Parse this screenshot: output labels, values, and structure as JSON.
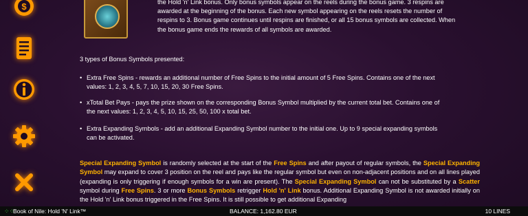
{
  "sidebar": {
    "items": [
      {
        "name": "coins",
        "icon": "coin-stack-icon"
      },
      {
        "name": "paytable",
        "icon": "scroll-icon"
      },
      {
        "name": "info",
        "icon": "info-icon"
      },
      {
        "name": "settings",
        "icon": "gear-icon"
      },
      {
        "name": "close",
        "icon": "close-icon"
      }
    ],
    "icon_color": "#ff9900"
  },
  "intro_lines": [
    "the Hold 'n' Link bonus. Only bonus symbols appear on the reels during the bonus game. 3 respins are",
    "awarded at the beginning of the bonus. Each new symbol appearing on the reels resets the number of",
    "respins to 3. Bonus game continues until respins are finished, or all 15 bonus symbols are collected. When",
    "the bonus game ends the rewards of all symbols are awarded."
  ],
  "types_heading": "3 types of Bonus Symbols presented:",
  "bullets": [
    {
      "line1": "Extra Free Spins - rewards an additional number of Free Spins to the initial amount of 5 Free Spins. Contains one of the next",
      "line2": "values: 1, 2, 3, 4, 5, 7, 10, 15, 20, 30 Free Spins."
    },
    {
      "line1": "xTotal Bet Pays - pays the prize shown on the corresponding Bonus Symbol multiplied by the current total bet. Contains one of",
      "line2": "the next values: 1, 2, 3, 4, 5, 10, 15, 25, 50, 100 x total bet."
    },
    {
      "line1": "Extra Expanding Symbols - add an additional Expanding Symbol number to the initial one. Up to 9 special expanding symbols",
      "line2": "can be activated."
    }
  ],
  "paragraph": {
    "ses": "Special Expanding Symbol",
    "free_spins": "Free Spins",
    "special": "Special",
    "expanding_symbol": "Expanding Symbol",
    "scatter": "Scatter",
    "free_spins_dot": "Free Spins",
    "bonus_symbols": "Bonus Symbols",
    "hold_n_link": "Hold 'n' Link",
    "t1": " is randomly selected at the start of the ",
    "t2": " and after payout of regular symbols, the ",
    "t3": " may expand to cover 3 position on the reel and pays like the regular symbol but even on non-adjacent positions and on all lines played (expanding is only triggering if enough symbols for a win are present). The ",
    "t4": " can not be substituted by a ",
    "t5": " symbol during ",
    "t6": ". 3 or more ",
    "t7": " retrigger ",
    "t8": " bonus. Additional Expanding Symbol is not awarded initially on the Hold 'n' Link bonus triggered in the Free Spins. It is still possible to get additional Expanding"
  },
  "footer": {
    "menu_icon": "menu-grid-icon",
    "game_title": "Book of Nile: Hold 'N' Link™",
    "balance": "BALANCE: 1,162.80 EUR",
    "lines": "10 LINES"
  },
  "colors": {
    "highlight": "#ffb400",
    "background": "#2a1030",
    "footer": "#0c0c0c",
    "menu_icon": "#3ecf3e"
  }
}
